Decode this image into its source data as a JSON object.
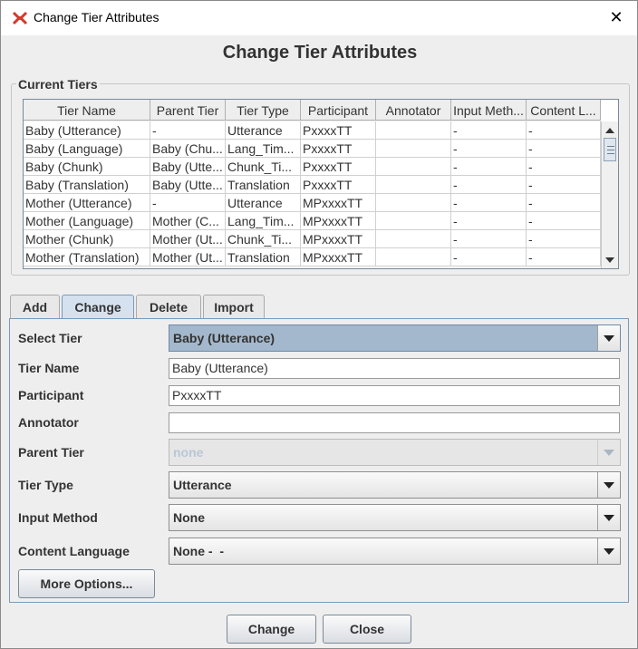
{
  "window": {
    "title": "Change Tier Attributes",
    "close_glyph": "✕"
  },
  "dialog": {
    "heading": "Change Tier Attributes"
  },
  "current_tiers": {
    "legend": "Current Tiers",
    "columns": [
      "Tier Name",
      "Parent Tier",
      "Tier Type",
      "Participant",
      "Annotator",
      "Input Meth...",
      "Content L..."
    ],
    "rows": [
      [
        "Baby (Utterance)",
        "-",
        "Utterance",
        "PxxxxTT",
        "",
        "-",
        "-"
      ],
      [
        "Baby (Language)",
        "Baby (Chu...",
        "Lang_Tim...",
        "PxxxxTT",
        "",
        "-",
        "-"
      ],
      [
        "Baby (Chunk)",
        "Baby (Utte...",
        "Chunk_Ti...",
        "PxxxxTT",
        "",
        "-",
        "-"
      ],
      [
        "Baby (Translation)",
        "Baby (Utte...",
        "Translation",
        "PxxxxTT",
        "",
        "-",
        "-"
      ],
      [
        "Mother (Utterance)",
        "-",
        "Utterance",
        "MPxxxxTT",
        "",
        "-",
        "-"
      ],
      [
        "Mother (Language)",
        "Mother (C...",
        "Lang_Tim...",
        "MPxxxxTT",
        "",
        "-",
        "-"
      ],
      [
        "Mother (Chunk)",
        "Mother (Ut...",
        "Chunk_Ti...",
        "MPxxxxTT",
        "",
        "-",
        "-"
      ],
      [
        "Mother (Translation)",
        "Mother (Ut...",
        "Translation",
        "MPxxxxTT",
        "",
        "-",
        "-"
      ]
    ]
  },
  "tabs": [
    {
      "label": "Add",
      "active": false
    },
    {
      "label": "Change",
      "active": true
    },
    {
      "label": "Delete",
      "active": false
    },
    {
      "label": "Import",
      "active": false
    }
  ],
  "form": {
    "select_tier": {
      "label": "Select Tier",
      "value": "Baby (Utterance)"
    },
    "tier_name": {
      "label": "Tier Name",
      "value": "Baby (Utterance)"
    },
    "participant": {
      "label": "Participant",
      "value": "PxxxxTT"
    },
    "annotator": {
      "label": "Annotator",
      "value": ""
    },
    "parent_tier": {
      "label": "Parent Tier",
      "value": "none"
    },
    "tier_type": {
      "label": "Tier Type",
      "value": "Utterance"
    },
    "input_method": {
      "label": "Input Method",
      "value": "None"
    },
    "content_language": {
      "label": "Content Language",
      "value": "None -  -"
    },
    "more_options_label": "More Options..."
  },
  "buttons": {
    "change": "Change",
    "close": "Close"
  },
  "colors": {
    "tab_active": "#d5e1ee",
    "selection": "#a3b8cc",
    "panel_border": "#7a9ab9"
  },
  "icons": {
    "app": "elan-app-icon",
    "close": "close-icon",
    "dropdown": "chevron-down-icon"
  }
}
